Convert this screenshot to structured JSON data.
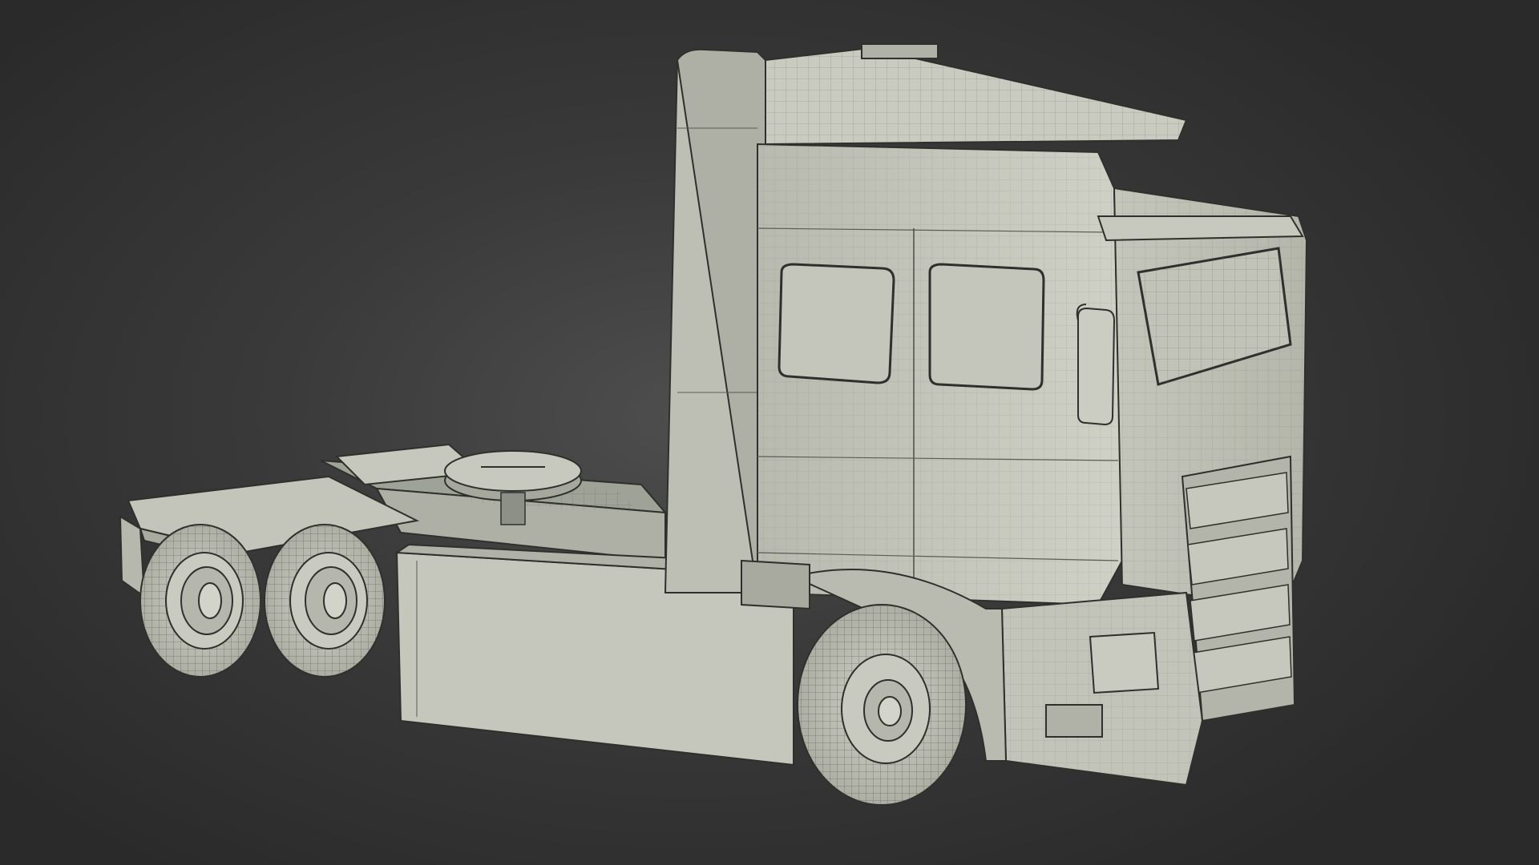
{
  "scene": {
    "subject": "truck-tractor-wireframe",
    "colors": {
      "background": "#2c2c2c",
      "model_fill": "#c9cbc1",
      "model_shade": "#a7aa9f",
      "model_dark": "#8d9086",
      "wire": "#5a5c55",
      "edge": "#2e302b"
    }
  }
}
